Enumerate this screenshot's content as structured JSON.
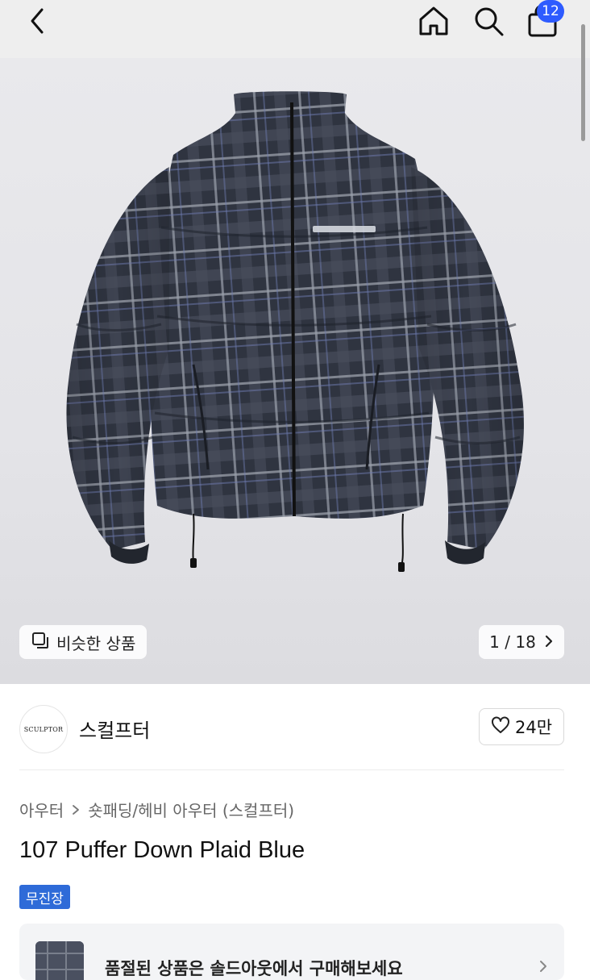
{
  "header": {
    "cart_count": "12"
  },
  "gallery": {
    "similar_label": "비슷한 상품",
    "counter": "1 / 18"
  },
  "brand": {
    "logo_text": "SCULPTOR",
    "name": "스컬프터",
    "likes": "24만"
  },
  "breadcrumb": {
    "category": "아우터",
    "subcategory": "숏패딩/헤비 아우터 (스컬프터)"
  },
  "product": {
    "title": "107 Puffer Down Plaid Blue",
    "badge": "무진장"
  },
  "promo": {
    "text": "품절된 상품은 솔드아웃에서 구매해보세요"
  },
  "colors": {
    "accent": "#2e5bff",
    "badge_bg": "#2e6bd8"
  }
}
